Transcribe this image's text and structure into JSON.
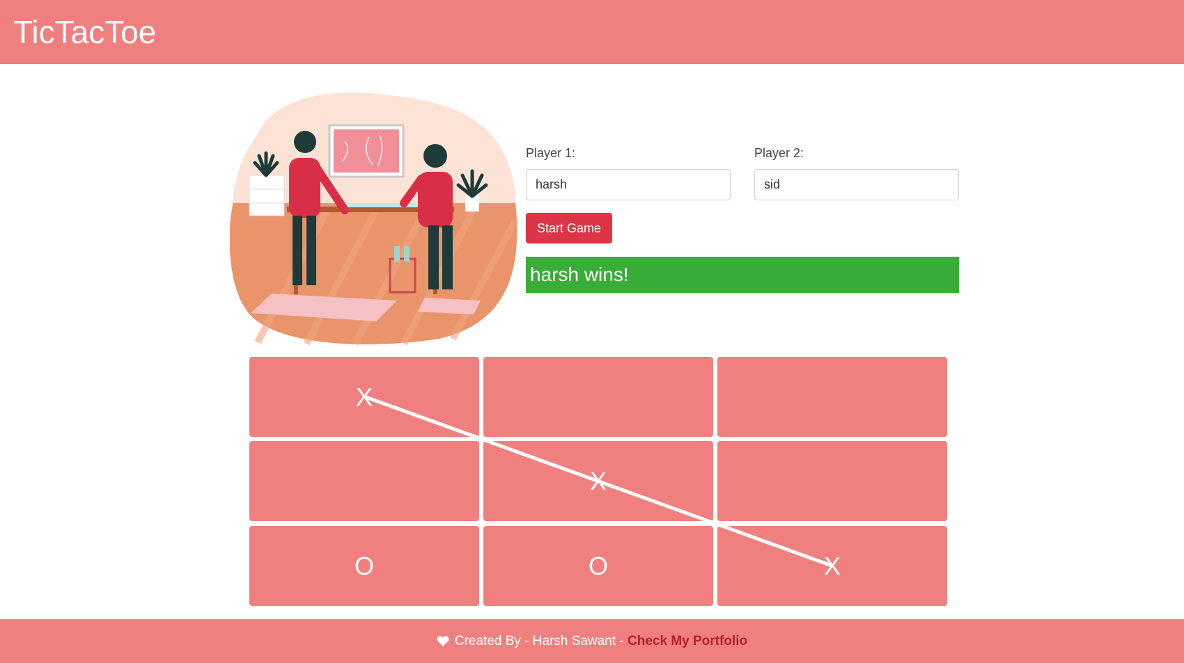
{
  "header": {
    "title": "TicTacToe"
  },
  "players": {
    "player1_label": "Player 1:",
    "player1_value": "harsh",
    "player2_label": "Player 2:",
    "player2_value": "sid"
  },
  "start_button_label": "Start Game",
  "status_message": "harsh wins!",
  "board": {
    "cells": [
      "X",
      "",
      "",
      "",
      "X",
      "",
      "O",
      "O",
      "X"
    ],
    "winning_line": "diagonal from top-left to bottom-right"
  },
  "footer": {
    "created_by": "Created By - Harsh Sawant -",
    "portfolio_link": "Check My Portfolio",
    "heart_icon": "heart-icon"
  },
  "colors": {
    "primary": "#f08080",
    "button": "#dc3545",
    "success": "#38ae38",
    "link": "#b5202f"
  }
}
